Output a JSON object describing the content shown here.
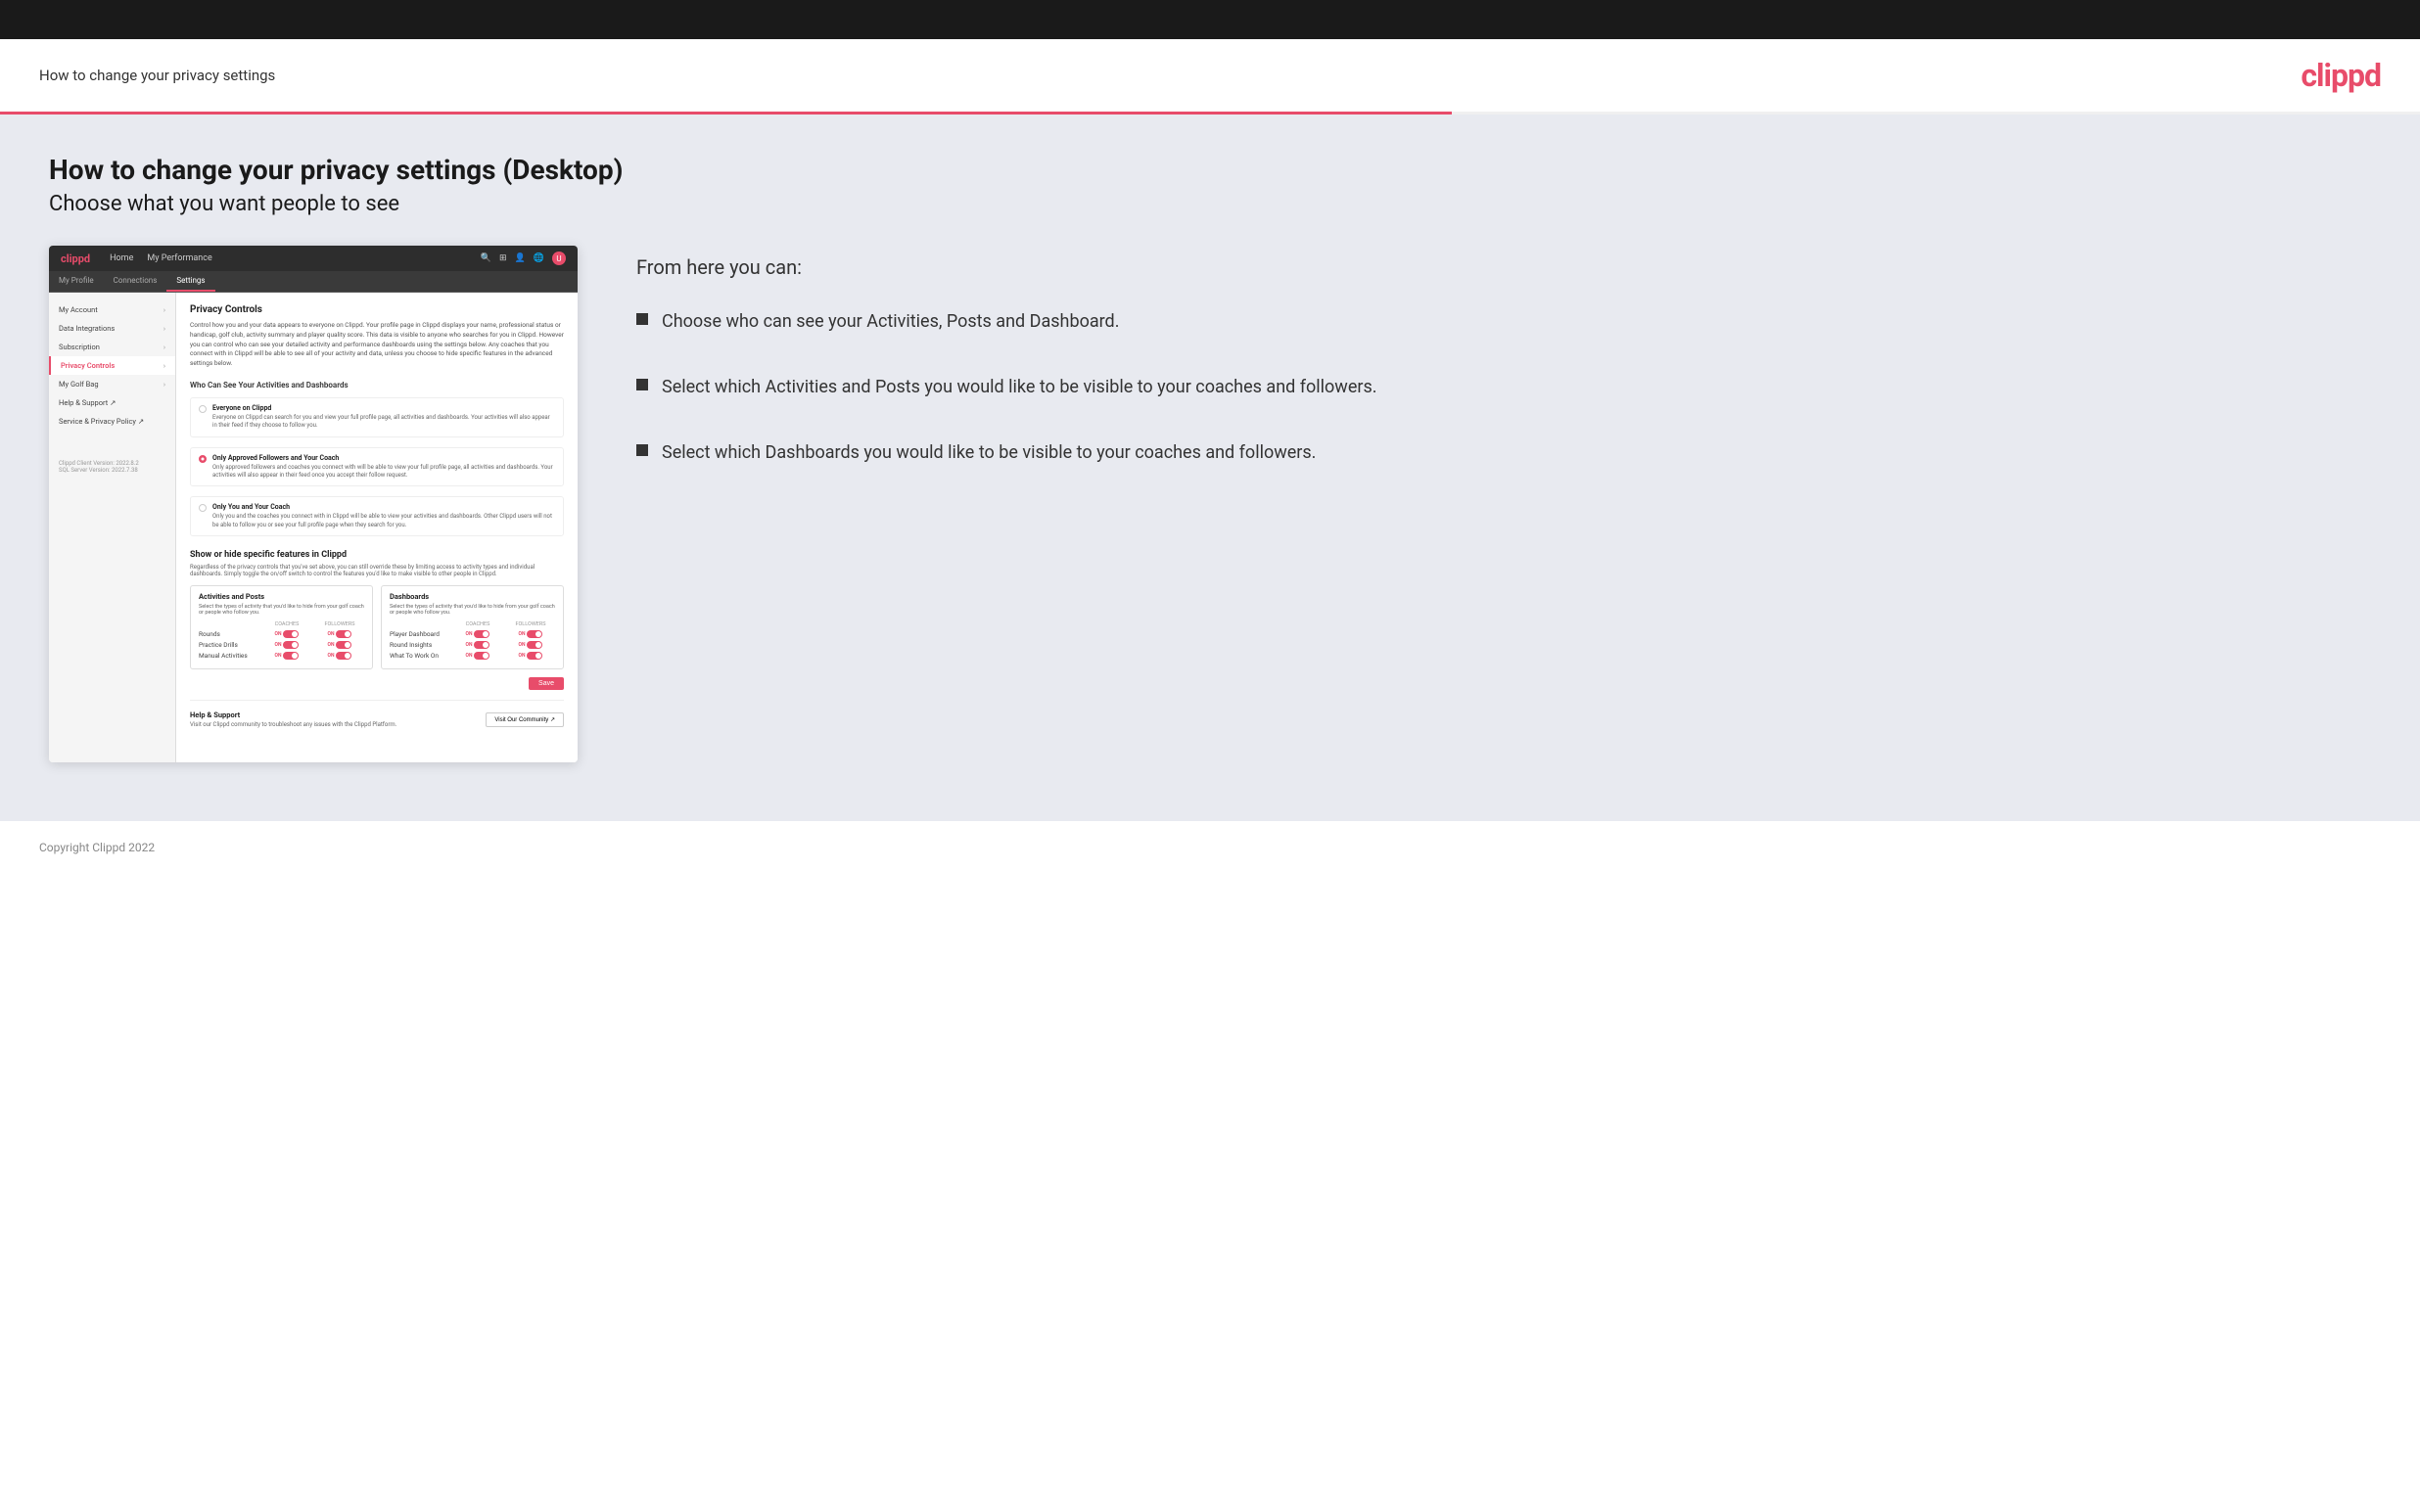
{
  "header": {
    "title": "How to change your privacy settings",
    "logo": "clippd"
  },
  "page": {
    "title": "How to change your privacy settings (Desktop)",
    "subtitle": "Choose what you want people to see"
  },
  "app_mockup": {
    "nav": {
      "logo": "clippd",
      "links": [
        "Home",
        "My Performance"
      ],
      "icons": [
        "search",
        "grid",
        "user",
        "globe",
        "avatar"
      ]
    },
    "tabs": [
      "My Profile",
      "Connections",
      "Settings"
    ],
    "active_tab": "Settings",
    "sidebar": {
      "items": [
        {
          "label": "My Account",
          "has_chevron": true,
          "active": false
        },
        {
          "label": "Data Integrations",
          "has_chevron": true,
          "active": false
        },
        {
          "label": "Subscription",
          "has_chevron": true,
          "active": false
        },
        {
          "label": "Privacy Controls",
          "has_chevron": true,
          "active": true
        },
        {
          "label": "My Golf Bag",
          "has_chevron": true,
          "active": false
        },
        {
          "label": "Help & Support ↗",
          "has_chevron": false,
          "active": false
        },
        {
          "label": "Service & Privacy Policy ↗",
          "has_chevron": false,
          "active": false
        }
      ],
      "version": "Clippd Client Version: 2022.8.2\nSQL Server Version: 2022.7.38"
    },
    "main": {
      "section_title": "Privacy Controls",
      "section_desc": "Control how you and your data appears to everyone on Clippd. Your profile page in Clippd displays your name, professional status or handicap, golf club, activity summary and player quality score. This data is visible to anyone who searches for you in Clippd. However you can control who can see your detailed activity and performance dashboards using the settings below. Any coaches that you connect with in Clippd will be able to see all of your activity and data, unless you choose to hide specific features in the advanced settings below.",
      "who_can_see_title": "Who Can See Your Activities and Dashboards",
      "radio_options": [
        {
          "id": "everyone",
          "label": "Everyone on Clippd",
          "desc": "Everyone on Clippd can search for you and view your full profile page, all activities and dashboards. Your activities will also appear in their feed if they choose to follow you.",
          "selected": false
        },
        {
          "id": "followers",
          "label": "Only Approved Followers and Your Coach",
          "desc": "Only approved followers and coaches you connect with will be able to view your full profile page, all activities and dashboards. Your activities will also appear in their feed once you accept their follow request.",
          "selected": true
        },
        {
          "id": "coach_only",
          "label": "Only You and Your Coach",
          "desc": "Only you and the coaches you connect with in Clippd will be able to view your activities and dashboards. Other Clippd users will not be able to follow you or see your full profile page when they search for you.",
          "selected": false
        }
      ],
      "show_hide_title": "Show or hide specific features in Clippd",
      "show_hide_desc": "Regardless of the privacy controls that you've set above, you can still override these by limiting access to activity types and individual dashboards. Simply toggle the on/off switch to control the features you'd like to make visible to other people in Clippd.",
      "activities_card": {
        "title": "Activities and Posts",
        "desc": "Select the types of activity that you'd like to hide from your golf coach or people who follow you.",
        "headers": [
          "COACHES",
          "FOLLOWERS"
        ],
        "rows": [
          {
            "label": "Rounds",
            "coaches_on": true,
            "followers_on": true
          },
          {
            "label": "Practice Drills",
            "coaches_on": true,
            "followers_on": true
          },
          {
            "label": "Manual Activities",
            "coaches_on": true,
            "followers_on": true
          }
        ]
      },
      "dashboards_card": {
        "title": "Dashboards",
        "desc": "Select the types of activity that you'd like to hide from your golf coach or people who follow you.",
        "headers": [
          "COACHES",
          "FOLLOWERS"
        ],
        "rows": [
          {
            "label": "Player Dashboard",
            "coaches_on": true,
            "followers_on": true
          },
          {
            "label": "Round Insights",
            "coaches_on": true,
            "followers_on": true
          },
          {
            "label": "What To Work On",
            "coaches_on": true,
            "followers_on": true
          }
        ]
      },
      "save_label": "Save",
      "help": {
        "title": "Help & Support",
        "desc": "Visit our Clippd community to troubleshoot any issues with the Clippd Platform.",
        "button": "Visit Our Community ↗"
      }
    }
  },
  "right_panel": {
    "from_here_title": "From here you can:",
    "bullets": [
      "Choose who can see your Activities, Posts and Dashboard.",
      "Select which Activities and Posts you would like to be visible to your coaches and followers.",
      "Select which Dashboards you would like to be visible to your coaches and followers."
    ]
  },
  "footer": {
    "copyright": "Copyright Clippd 2022"
  }
}
